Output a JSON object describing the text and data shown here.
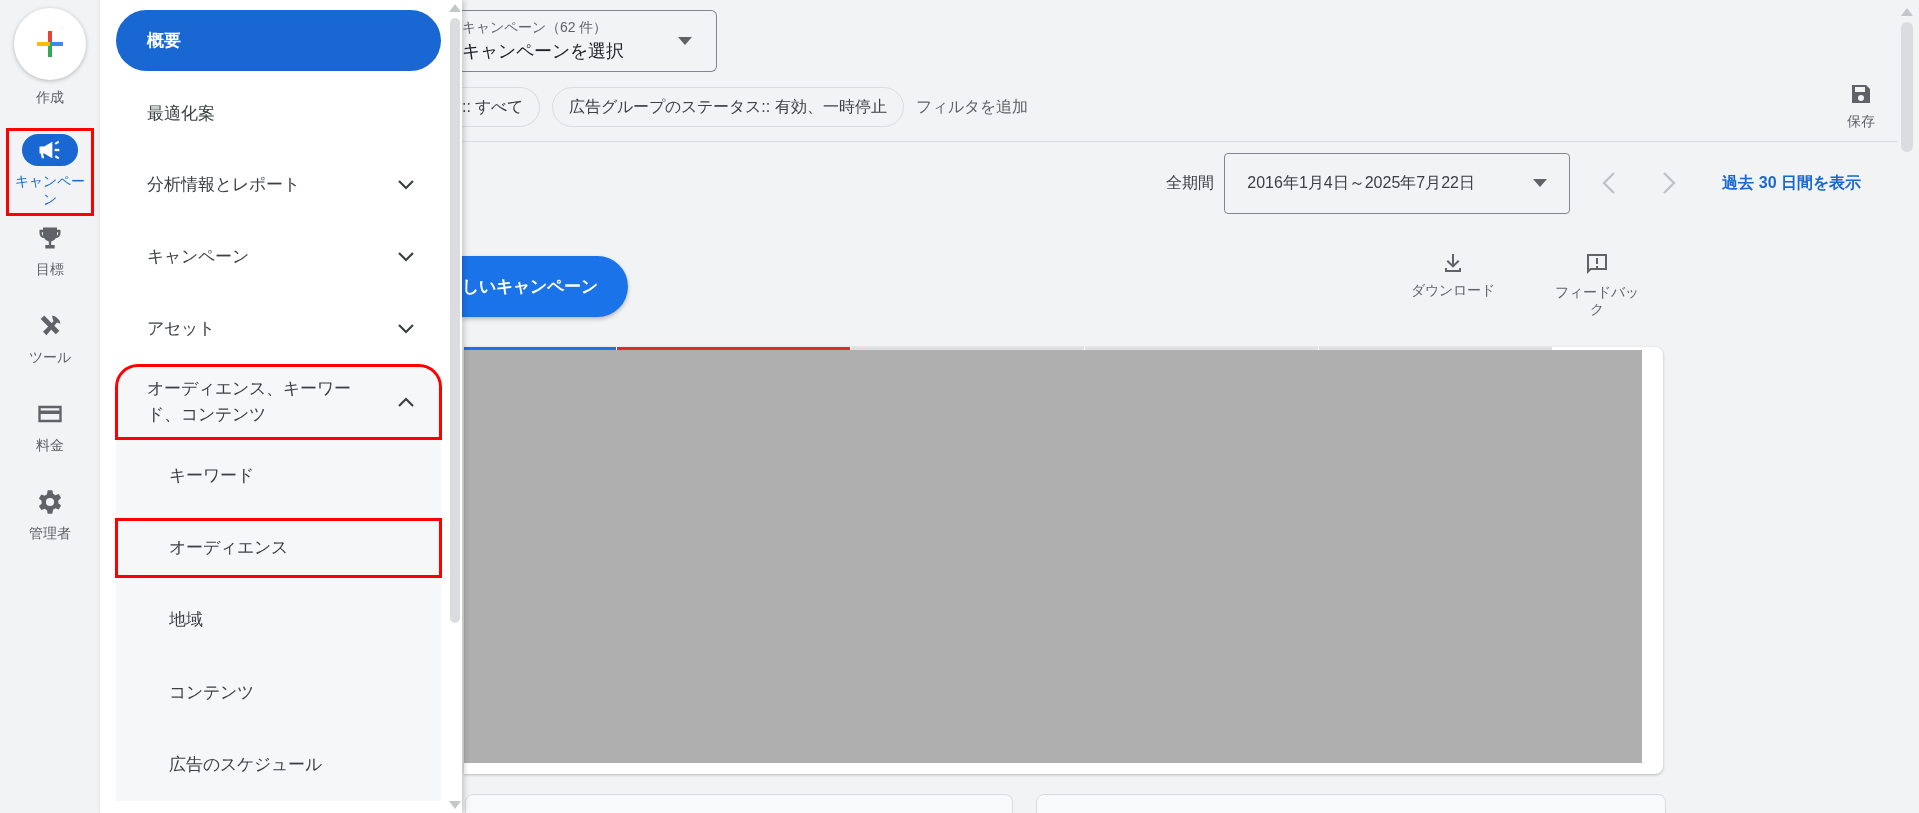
{
  "rail": {
    "create": {
      "label": "作成"
    },
    "items": [
      {
        "kind": "megaphone",
        "label": "キャンペーン",
        "selected": true,
        "highlighted": true
      },
      {
        "kind": "trophy",
        "label": "目標",
        "selected": false,
        "highlighted": false
      },
      {
        "kind": "tools",
        "label": "ツール",
        "selected": false,
        "highlighted": false
      },
      {
        "kind": "card",
        "label": "料金",
        "selected": false,
        "highlighted": false
      },
      {
        "kind": "gear",
        "label": "管理者",
        "selected": false,
        "highlighted": false
      }
    ]
  },
  "nav": {
    "items": [
      {
        "kind": "link",
        "label": "概要",
        "selected": true,
        "highlighted": false
      },
      {
        "kind": "link",
        "label": "最適化案",
        "selected": false,
        "highlighted": false
      },
      {
        "kind": "group",
        "label": "分析情報とレポート",
        "expanded": false,
        "highlighted": false
      },
      {
        "kind": "group",
        "label": "キャンペーン",
        "expanded": false,
        "highlighted": false
      },
      {
        "kind": "group",
        "label": "アセット",
        "expanded": false,
        "highlighted": false
      },
      {
        "kind": "group",
        "label": "オーディエンス、キーワード、コンテンツ",
        "expanded": true,
        "highlighted": true,
        "children": [
          {
            "label": "キーワード",
            "selected": false,
            "highlighted": false
          },
          {
            "label": "オーディエンス",
            "selected": false,
            "highlighted": true
          },
          {
            "label": "地域",
            "selected": false,
            "highlighted": false
          },
          {
            "label": "コンテンツ",
            "selected": false,
            "highlighted": false
          },
          {
            "label": "広告のスケジュール",
            "selected": false,
            "highlighted": false
          }
        ]
      }
    ]
  },
  "campaign_picker": {
    "label": "キャンペーン（62 件）",
    "value": "キャンペーンを選択"
  },
  "filters": [
    {
      "label": ":: すべて"
    },
    {
      "label": "広告グループのステータス:: 有効、一時停止"
    }
  ],
  "add_filter": "フィルタを追加",
  "save": {
    "label": "保存"
  },
  "date": {
    "label": "全期間",
    "range": "2016年1月4日～2025年7月22日",
    "link": "過去 30 日間を表示"
  },
  "new_campaign": {
    "label": "しいキャンペーン"
  },
  "actions": [
    {
      "kind": "download",
      "label": "ダウンロード"
    },
    {
      "kind": "feedback",
      "label": "フィードバック"
    }
  ],
  "overview_card": {
    "metric_tabs": [
      {
        "color": "#1a73e8"
      },
      {
        "color": "#d93025"
      },
      {
        "color": "#e0e0e0"
      },
      {
        "color": "#e0e0e0"
      },
      {
        "color": "#e0e0e0"
      }
    ]
  }
}
